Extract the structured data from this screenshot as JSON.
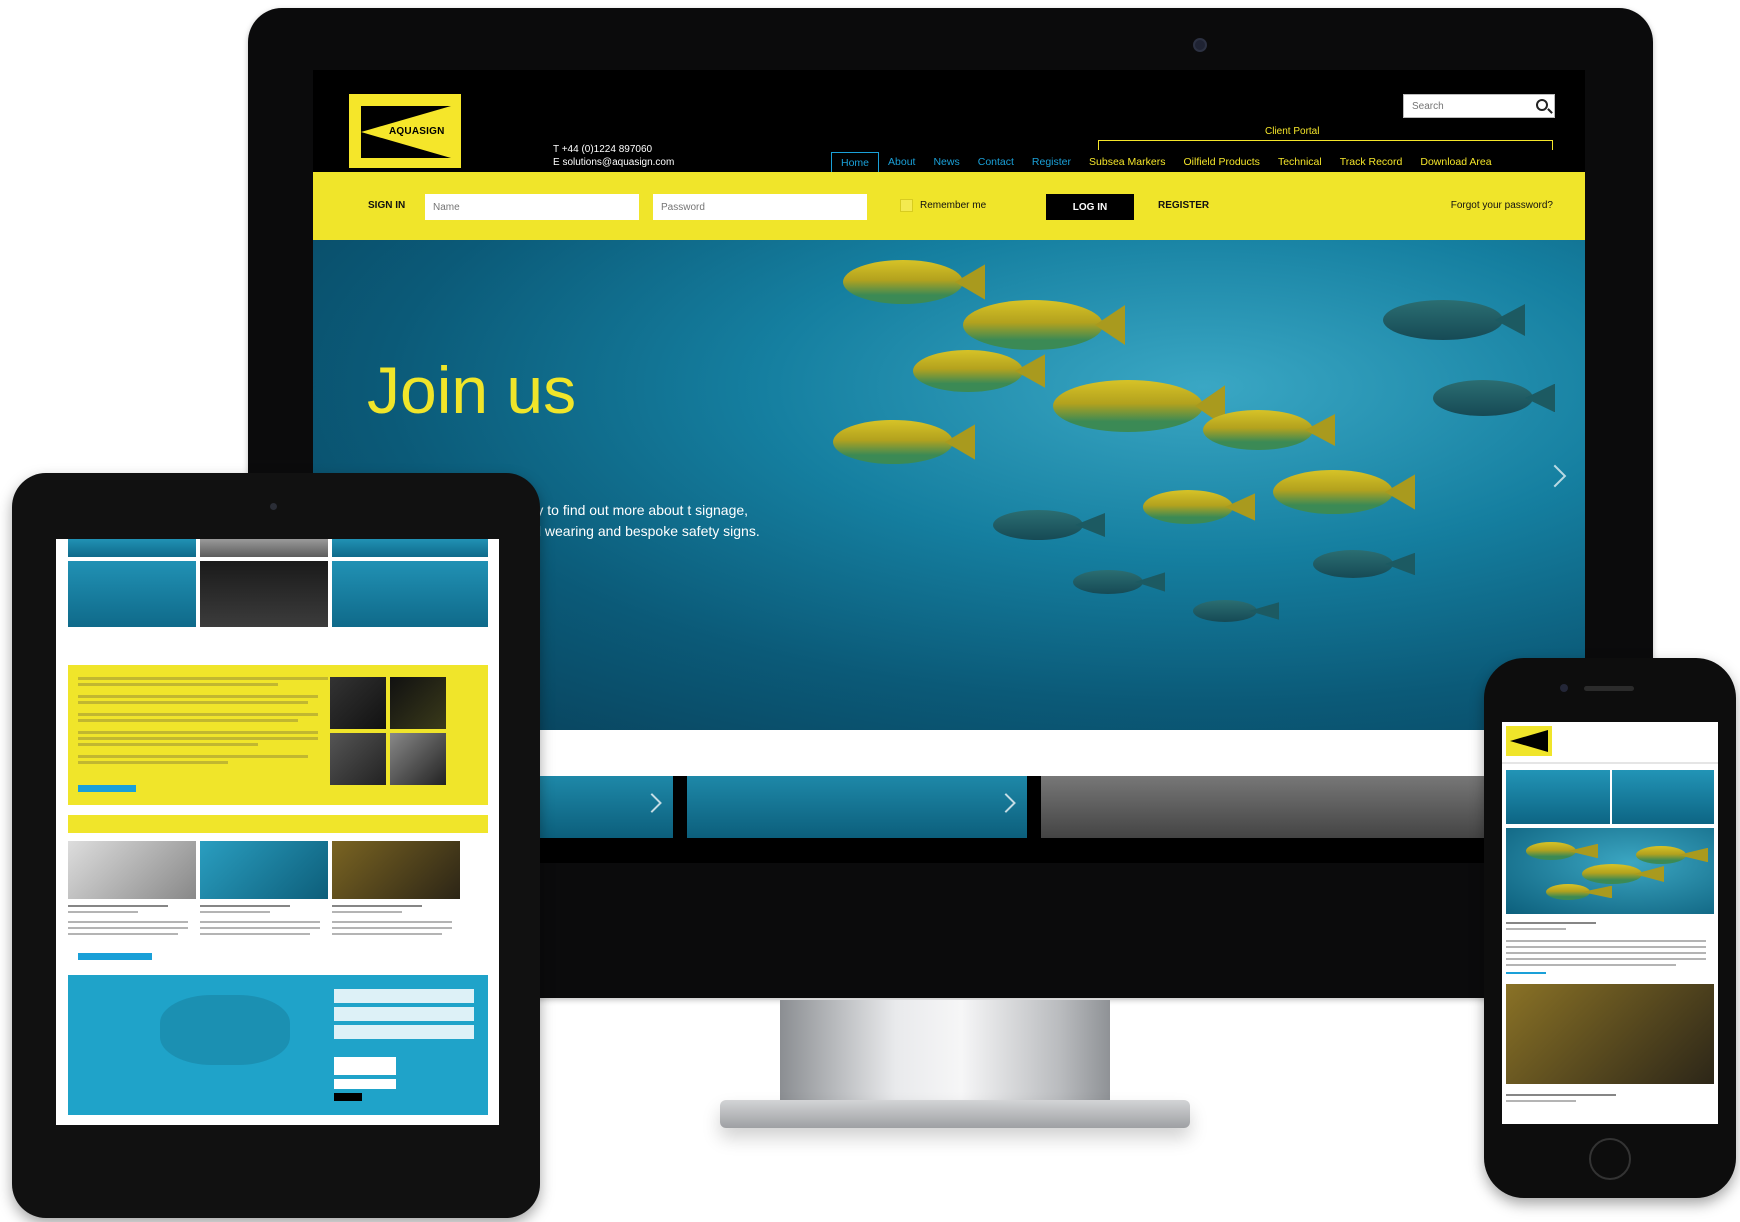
{
  "desktop": {
    "logo_text": "AQUASIGN",
    "contact": {
      "phone": "T  +44 (0)1224 897060",
      "email": "E  solutions@aquasign.com"
    },
    "search": {
      "placeholder": "Search"
    },
    "client_portal_label": "Client Portal",
    "nav": {
      "home": "Home",
      "about": "About",
      "news": "News",
      "contact": "Contact",
      "register": "Register",
      "subsea_markers": "Subsea Markers",
      "oilfield_products": "Oilfield Products",
      "technical": "Technical",
      "track_record": "Track Record",
      "download_area": "Download  Area"
    },
    "signin": {
      "label": "SIGN IN",
      "name_placeholder": "Name",
      "password_placeholder": "Password",
      "remember": "Remember me",
      "login": "LOG IN",
      "register": "REGISTER",
      "forgot": "Forgot your password?"
    },
    "hero": {
      "title": "Join us",
      "text": "oday to find out more about t signage, hard wearing and bespoke safety signs."
    }
  },
  "colors": {
    "brand_yellow": "#f0e52a",
    "link_blue": "#1aa0d8",
    "ocean": "#157fa0"
  },
  "icons": [
    "search-icon",
    "chevron-right-icon",
    "logo-icon"
  ]
}
